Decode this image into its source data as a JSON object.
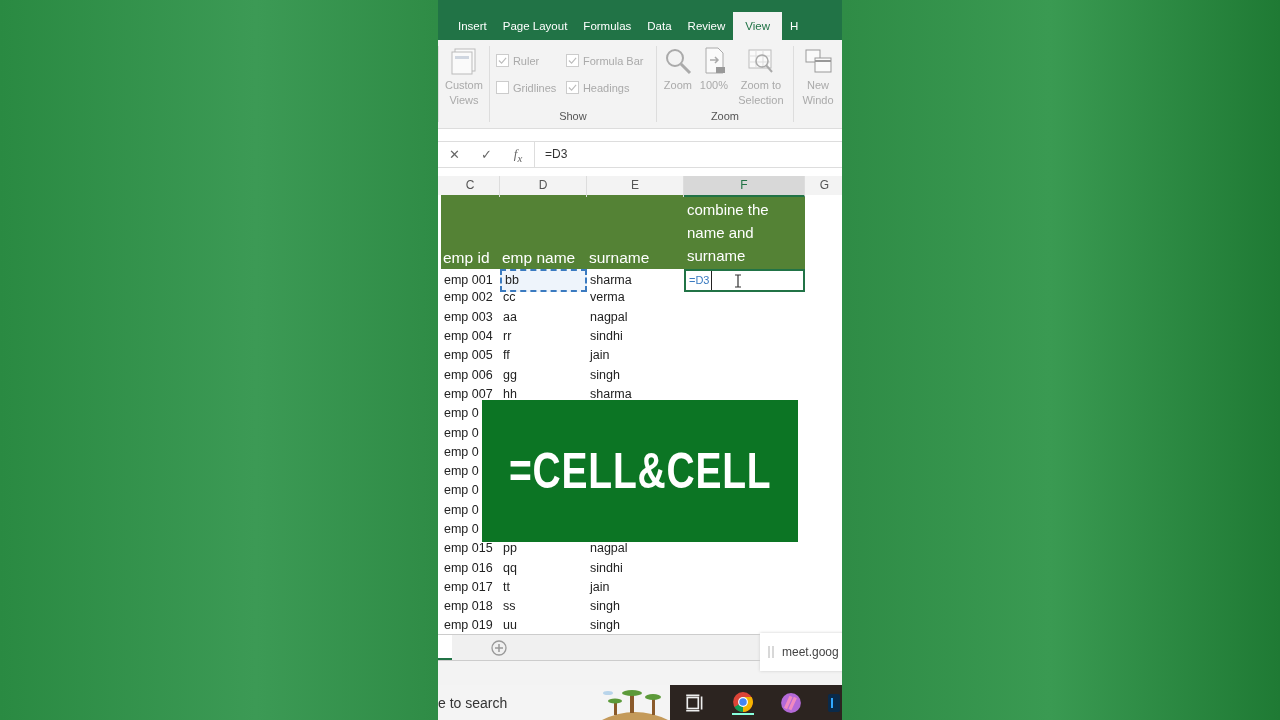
{
  "ribbon_tabs": [
    {
      "label": "Insert",
      "selected": false
    },
    {
      "label": "Page Layout",
      "selected": false
    },
    {
      "label": "Formulas",
      "selected": false
    },
    {
      "label": "Data",
      "selected": false
    },
    {
      "label": "Review",
      "selected": false
    },
    {
      "label": "View",
      "selected": true
    },
    {
      "label": "H",
      "selected": false
    }
  ],
  "ribbon": {
    "custom_views": "Custom Views",
    "show": {
      "label": "Show",
      "options": [
        {
          "label": "Ruler",
          "checked": true
        },
        {
          "label": "Formula Bar",
          "checked": true
        },
        {
          "label": "Gridlines",
          "checked": false
        },
        {
          "label": "Headings",
          "checked": true
        }
      ]
    },
    "zoom": {
      "label": "Zoom",
      "buttons": [
        {
          "label": "Zoom",
          "kind": "zoom"
        },
        {
          "label": "100%",
          "kind": "hundred"
        },
        {
          "label": "Zoom to Selection",
          "kind": "selection"
        }
      ]
    },
    "new_window": "New Windo"
  },
  "formula_bar": {
    "cancel": "✕",
    "enter": "✓",
    "function": "f$_{x}$",
    "value": "=D3"
  },
  "columns": [
    {
      "label": "C",
      "selected": false
    },
    {
      "label": "D",
      "selected": false
    },
    {
      "label": "E",
      "selected": false
    },
    {
      "label": "F",
      "selected": true
    },
    {
      "label": "G",
      "selected": false
    }
  ],
  "header_row": [
    "emp id",
    "emp name",
    "surname",
    "combine the name and surname"
  ],
  "rows": [
    {
      "id": "emp 001",
      "name": "bb",
      "surname": "sharma",
      "combined": "=D3",
      "referenced": true,
      "editing": true
    },
    {
      "id": "emp 002",
      "name": "cc",
      "surname": "verma",
      "referenced": false,
      "editing": false
    },
    {
      "id": "emp 003",
      "name": "aa",
      "surname": "nagpal",
      "referenced": false,
      "editing": false
    },
    {
      "id": "emp 004",
      "name": "rr",
      "surname": "sindhi",
      "referenced": false,
      "editing": false
    },
    {
      "id": "emp 005",
      "name": "ff",
      "surname": "jain",
      "referenced": false,
      "editing": false
    },
    {
      "id": "emp 006",
      "name": "gg",
      "surname": "singh",
      "referenced": false,
      "editing": false
    },
    {
      "id": "emp 007",
      "name": "hh",
      "surname": "sharma",
      "referenced": false,
      "editing": false
    },
    {
      "id": "emp 0",
      "referenced": false,
      "editing": false
    },
    {
      "id": "emp 0",
      "referenced": false,
      "editing": false
    },
    {
      "id": "emp 0",
      "referenced": false,
      "editing": false
    },
    {
      "id": "emp 0",
      "referenced": false,
      "editing": false
    },
    {
      "id": "emp 0",
      "referenced": false,
      "editing": false
    },
    {
      "id": "emp 0",
      "referenced": false,
      "editing": false
    },
    {
      "id": "emp 0",
      "referenced": false,
      "editing": false
    },
    {
      "id": "emp 015",
      "name": "pp",
      "surname": "nagpal",
      "referenced": false,
      "editing": false
    },
    {
      "id": "emp 016",
      "name": "qq",
      "surname": "sindhi",
      "referenced": false,
      "editing": false
    },
    {
      "id": "emp 017",
      "name": "tt",
      "surname": "jain",
      "referenced": false,
      "editing": false
    },
    {
      "id": "emp 018",
      "name": "ss",
      "surname": "singh",
      "referenced": false,
      "editing": false
    },
    {
      "id": "emp 019",
      "name": "uu",
      "surname": "singh",
      "referenced": false,
      "editing": false
    }
  ],
  "banner": "=CELL&CELL",
  "notification": "meet.goog",
  "taskbar": {
    "search": "e to search",
    "apps": [
      {
        "kind": "task-view"
      },
      {
        "kind": "chrome",
        "selected": true
      },
      {
        "kind": "app",
        "selected": false
      },
      {
        "kind": "ps",
        "selected": false
      }
    ]
  }
}
